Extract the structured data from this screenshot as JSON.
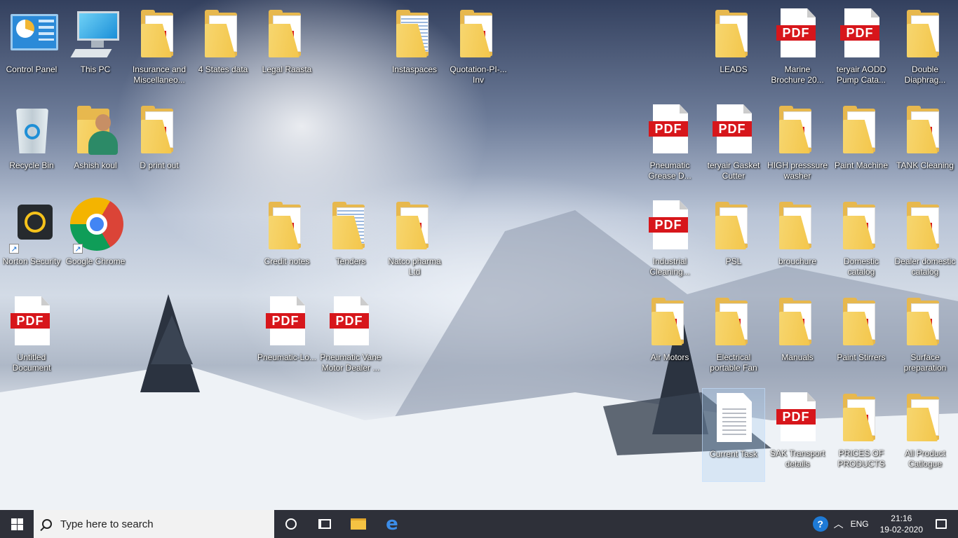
{
  "desktop": {
    "icons": [
      {
        "label": "Control Panel",
        "type": "controlpanel"
      },
      {
        "label": "This PC",
        "type": "thispc"
      },
      {
        "label": "Insurance and Miscellaneo...",
        "type": "folder-pdf"
      },
      {
        "label": "4 States data",
        "type": "folder"
      },
      {
        "label": "Legal Raasta",
        "type": "folder-pdf"
      },
      {
        "label": "Instaspaces",
        "type": "folder-doc"
      },
      {
        "label": "Quotation-PI-... Inv",
        "type": "folder-pdf"
      },
      {
        "label": "LEADS",
        "type": "folder"
      },
      {
        "label": "Marine Brochure 20...",
        "type": "pdf"
      },
      {
        "label": "teryair AODD Pump Cata...",
        "type": "pdf"
      },
      {
        "label": "Double Diaphrag...",
        "type": "folder"
      },
      {
        "label": "Recycle Bin",
        "type": "recyclebin"
      },
      {
        "label": "Ashish koul",
        "type": "user"
      },
      {
        "label": "D print out",
        "type": "folder-pdf"
      },
      {
        "label": "Pneumatic Grease D...",
        "type": "pdf"
      },
      {
        "label": "teryair Gasket Cutter",
        "type": "pdf"
      },
      {
        "label": "HIGH presssure washer",
        "type": "folder-pdf"
      },
      {
        "label": "Paint Machine",
        "type": "folder"
      },
      {
        "label": "TANK Cleaning",
        "type": "folder-pdf"
      },
      {
        "label": "Norton Security",
        "type": "norton"
      },
      {
        "label": "Google Chrome",
        "type": "chrome"
      },
      {
        "label": "Credit notes",
        "type": "folder-pdf"
      },
      {
        "label": "Tenders",
        "type": "folder-doc"
      },
      {
        "label": "Natco pharma Ltd",
        "type": "folder-pdf"
      },
      {
        "label": "Industrial Cleaning...",
        "type": "pdf"
      },
      {
        "label": "PSL",
        "type": "folder"
      },
      {
        "label": "brouchure",
        "type": "folder"
      },
      {
        "label": "Domestic catalog",
        "type": "folder-pdf"
      },
      {
        "label": "Dealer domestic catalog",
        "type": "folder-pdf"
      },
      {
        "label": "Untitled Document",
        "type": "pdf"
      },
      {
        "label": "Pneumatic-Lo...",
        "type": "pdf"
      },
      {
        "label": "Pneumatic Vane Motor Dealer ...",
        "type": "pdf"
      },
      {
        "label": "Air Motors",
        "type": "folder-pdf"
      },
      {
        "label": "Electrical portable Fan",
        "type": "folder-pdf"
      },
      {
        "label": "Manuals",
        "type": "folder-pdf"
      },
      {
        "label": "Paint Stirrers",
        "type": "folder-pdf"
      },
      {
        "label": "Surface preparation",
        "type": "folder-pdf"
      },
      {
        "label": "Current Task",
        "type": "doc"
      },
      {
        "label": "SAK Transport details",
        "type": "pdf"
      },
      {
        "label": "PRICES OF PRODUCTS",
        "type": "folder-pdf"
      },
      {
        "label": "All Product Catlogue",
        "type": "folder"
      }
    ]
  },
  "pdf_badge": "PDF",
  "taskbar": {
    "search_placeholder": "Type here to search",
    "language": "ENG",
    "time": "21:16",
    "date": "19-02-2020",
    "pinned": [
      "cortana-icon",
      "task-view-icon",
      "file-explorer-icon",
      "edge-icon"
    ]
  }
}
